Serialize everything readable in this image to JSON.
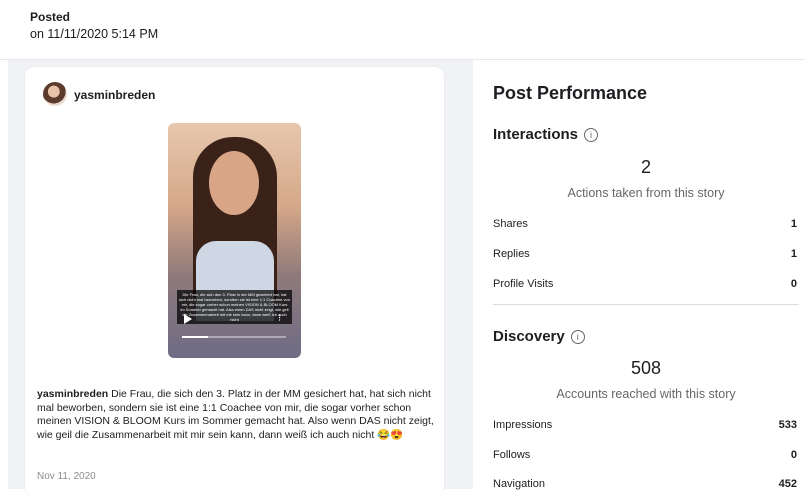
{
  "header": {
    "posted_label": "Posted",
    "posted_date": "on 11/11/2020 5:14 PM"
  },
  "post": {
    "username": "yasminbreden",
    "story_overlay_text": "Die Frau, die sich den 3. Platz in der MM gesichert hat, hat sich nicht mal beworben, sondern sie ist eine 1:1 Coachee von mir, die sogar vorher schon meinen VISION & BLOOM Kurs im Sommer gemacht hat. Also wenn DAS nicht zeigt, wie geil die Zusammenarbeit mit mir sein kann, dann weiß ich auch nicht",
    "story_progress": 0.25,
    "caption_user": "yasminbreden",
    "caption_text": " Die Frau, die sich den 3. Platz in der MM gesichert hat, hat sich nicht mal beworben, sondern sie ist eine 1:1 Coachee von mir, die sogar vorher schon meinen VISION & BLOOM Kurs im Sommer gemacht hat. Also wenn DAS nicht zeigt, wie geil die Zusammenarbeit mit mir sein kann, dann weiß ich auch nicht 😂😍",
    "date": "Nov 11, 2020"
  },
  "performance": {
    "title": "Post Performance",
    "interactions": {
      "title": "Interactions",
      "count": "2",
      "subtitle": "Actions taken from this story",
      "rows": [
        {
          "label": "Shares",
          "value": "1"
        },
        {
          "label": "Replies",
          "value": "1"
        },
        {
          "label": "Profile Visits",
          "value": "0"
        }
      ]
    },
    "discovery": {
      "title": "Discovery",
      "count": "508",
      "subtitle": "Accounts reached with this story",
      "rows": [
        {
          "label": "Impressions",
          "value": "533"
        },
        {
          "label": "Follows",
          "value": "0"
        },
        {
          "label": "Navigation",
          "value": "452"
        }
      ]
    }
  }
}
